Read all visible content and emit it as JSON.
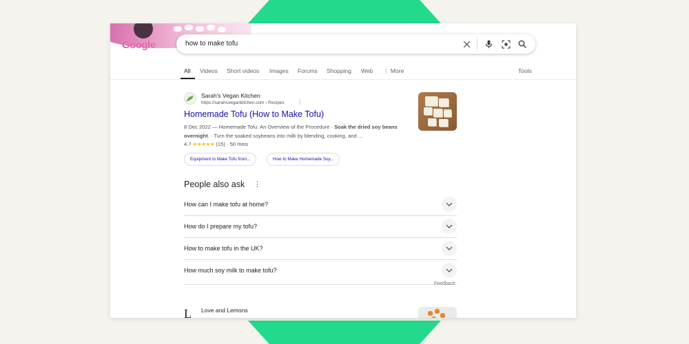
{
  "brand": {
    "logo_text": "Google"
  },
  "search": {
    "query": "how to make tofu"
  },
  "tabs": [
    {
      "label": "All",
      "active": true
    },
    {
      "label": "Videos"
    },
    {
      "label": "Short videos"
    },
    {
      "label": "Images"
    },
    {
      "label": "Forums"
    },
    {
      "label": "Shopping"
    },
    {
      "label": "Web"
    },
    {
      "label": "More"
    }
  ],
  "tools_label": "Tools",
  "result": {
    "site_name": "Sarah's Vegan Kitchen",
    "url": "https://sarahsvegankitchen.com › Recipes",
    "title": "Homemade Tofu (How to Make Tofu)",
    "date": "8 Dec 2022",
    "snippet_a": "Homemade Tofu: An Overview of the Procedure · ",
    "snippet_bold": "Soak the dried soy beans overnight",
    "snippet_b": ". · Turn the soaked soybeans into milk by blending, cooking, and ...",
    "rating": "4.7",
    "stars": "★★★★★",
    "review_count": "(15)",
    "time": "50 mins",
    "chips": [
      "Equipment to Make Tofu from...",
      "How to Make Homemade Soy..."
    ]
  },
  "people_also_ask": {
    "title": "People also ask",
    "questions": [
      "How can I make tofu at home?",
      "How do I prepare my tofu?",
      "How to make tofu in the UK?",
      "How much soy milk to make tofu?"
    ],
    "feedback_label": "Feedback"
  },
  "result2": {
    "site_name": "Love and Lemons",
    "favicon_letter": "L"
  },
  "colors": {
    "link": "#1a0dab",
    "accent_green": "#23d98b",
    "background": "#f5f3ee"
  }
}
